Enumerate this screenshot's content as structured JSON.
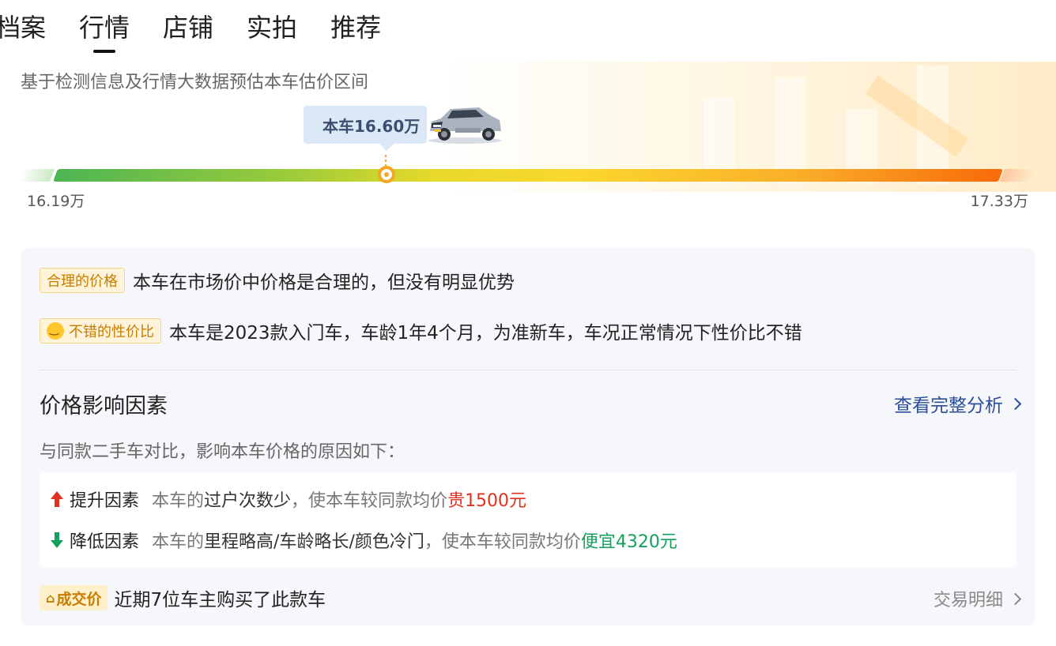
{
  "tabs": [
    {
      "label": "档案"
    },
    {
      "label": "行情"
    },
    {
      "label": "店铺"
    },
    {
      "label": "实拍"
    },
    {
      "label": "推荐"
    }
  ],
  "active_tab": "行情",
  "price_range": {
    "description": "基于检测信息及行情大数据预估本车估价区间",
    "current_label": "本车16.60万",
    "current_value": 16.6,
    "low_label": "16.19万",
    "high_label": "17.33万",
    "low_value": 16.19,
    "high_value": 17.33
  },
  "assessment": {
    "reasonable_badge": "合理的价格",
    "reasonable_text": "本车在市场价中价格是合理的，但没有明显优势",
    "value_badge": "不错的性价比",
    "value_text": "本车是2023款入门车，车龄1年4个月，为准新车，车况正常情况下性价比不错"
  },
  "factors": {
    "title": "价格影响因素",
    "full_analysis_label": "查看完整分析",
    "compare_desc": "与同款二手车对比，影响本车价格的原因如下：",
    "raise": {
      "label": "提升因素",
      "prefix": "本车的",
      "reason": "过户次数少",
      "middle": "，使本车较同款均价",
      "effect": "贵1500元"
    },
    "lower": {
      "label": "降低因素",
      "prefix": "本车的",
      "reason": "里程略高/车龄略长/颜色冷门",
      "middle": "，使本车较同款均价",
      "effect": "便宜4320元"
    }
  },
  "deal": {
    "badge": "成交价",
    "text": "近期7位车主购买了此款车",
    "detail_label": "交易明细"
  },
  "colors": {
    "accent_blue": "#2c4e9a",
    "raise_red": "#e0301e",
    "lower_green": "#16a05d",
    "badge_orange": "#c77d00"
  },
  "icons": [
    "car-icon",
    "smile-icon",
    "arrow-up-icon",
    "arrow-down-icon",
    "deal-icon",
    "chevron-right-icon"
  ]
}
